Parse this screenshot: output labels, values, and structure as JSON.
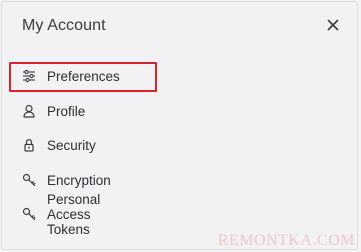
{
  "dialog": {
    "title": "My Account"
  },
  "menu": {
    "items": [
      {
        "label": "Preferences",
        "icon": "sliders-icon",
        "selected": true
      },
      {
        "label": "Profile",
        "icon": "user-icon"
      },
      {
        "label": "Security",
        "icon": "lock-icon"
      },
      {
        "label": "Encryption",
        "icon": "key-icon"
      },
      {
        "label": "Personal Access Tokens",
        "icon": "key-icon"
      }
    ]
  },
  "watermark": "REMONTKA.COM",
  "colors": {
    "highlight": "#d3262c",
    "background": "#f2f2f4",
    "text": "#2f2f33"
  }
}
